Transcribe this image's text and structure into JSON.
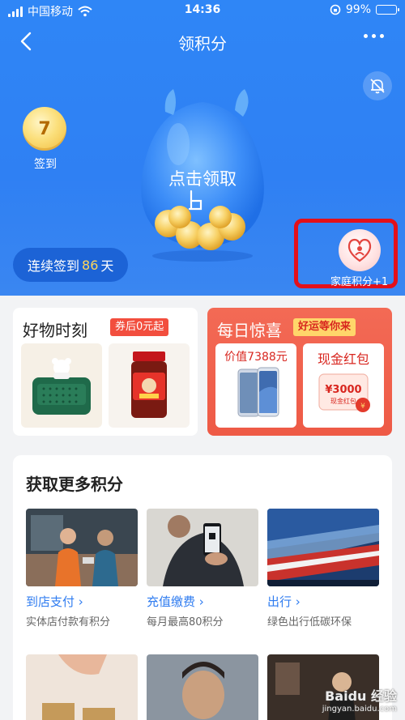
{
  "status_bar": {
    "carrier": "中国移动",
    "time": "14:36",
    "battery": "99%"
  },
  "nav": {
    "title": "领积分"
  },
  "hero": {
    "checkin_days": "7",
    "checkin_label": "签到",
    "claim_text": "点击领取",
    "streak_prefix": "连续签到",
    "streak_days": "86",
    "streak_suffix": "天",
    "family_label": "家庭积分+1"
  },
  "promo": {
    "good_title": "好物时刻",
    "good_tag": "券后0元起",
    "daily_title": "每日惊喜",
    "daily_tag": "好运等你来",
    "phone_price": "价值7388元",
    "cash_title": "现金红包",
    "cash_amount": "¥3000",
    "cash_note": "现金红包"
  },
  "more": {
    "title": "获取更多积分",
    "items": [
      {
        "name": "到店支付",
        "desc": "实体店付款有积分"
      },
      {
        "name": "充值缴费",
        "desc": "每月最高80积分"
      },
      {
        "name": "出行",
        "desc": "绿色出行低碳环保"
      }
    ]
  },
  "watermark": {
    "line1": "Baidu 经验",
    "line2": "jingyan.baidu.com"
  },
  "colors": {
    "hero_blue": "#2f86f6",
    "highlight_red": "#e3101a",
    "link_blue": "#2f7cf0",
    "promo_red": "#ee5a46"
  }
}
